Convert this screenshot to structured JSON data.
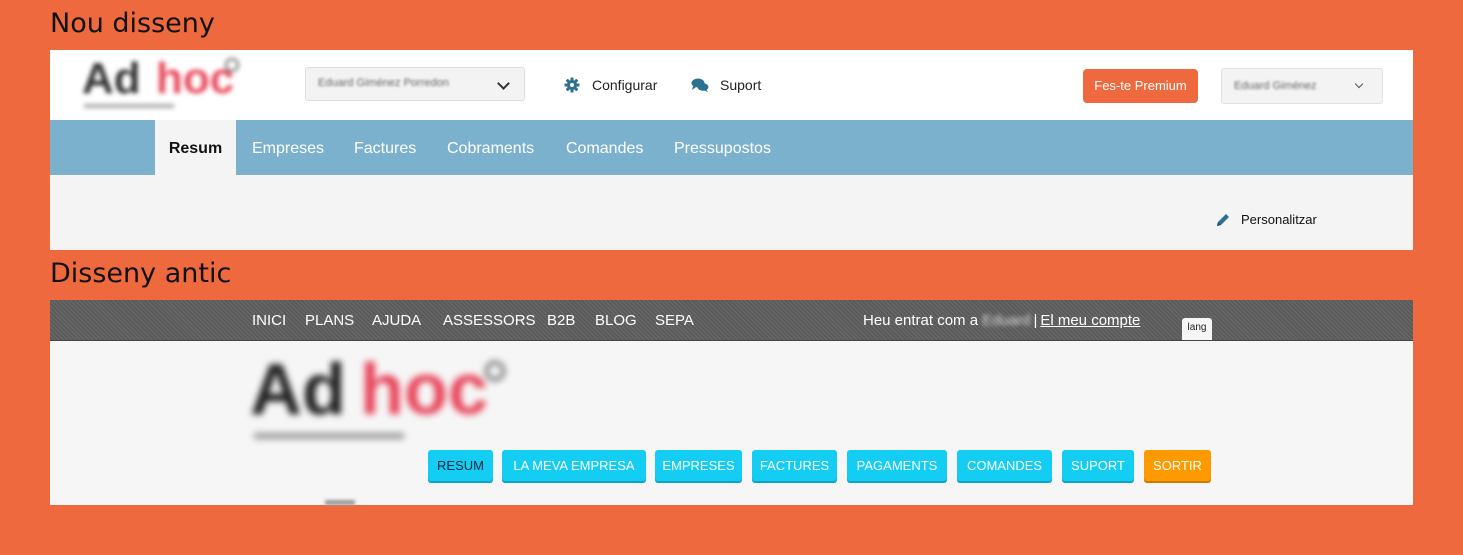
{
  "sections": {
    "new_title": "Nou disseny",
    "old_title": "Disseny antic"
  },
  "new_design": {
    "logo": {
      "text_left": "Ad",
      "text_right": "hoc",
      "brand_color": "#e84d5f"
    },
    "company_select": {
      "value": "Eduard Giménez Porredon"
    },
    "links": {
      "configurar": "Configurar",
      "suport": "Suport"
    },
    "premium_button": "Fes-te Premium",
    "user_select": {
      "value": "Eduard Giménez"
    },
    "nav": [
      "Resum",
      "Empreses",
      "Factures",
      "Cobraments",
      "Comandes",
      "Pressupostos"
    ],
    "active_nav": "Resum",
    "personalitzar": "Personalitzar",
    "colors": {
      "nav_bg": "#7bb1cd",
      "accent": "#ee6a3e"
    }
  },
  "old_design": {
    "top_links": [
      "INICI",
      "PLANS",
      "AJUDA",
      "ASSESSORS",
      "B2B",
      "BLOG",
      "SEPA"
    ],
    "account": {
      "prefix": "Heu entrat com a",
      "user": "Eduard",
      "separator": "|",
      "account_link": "El meu compte"
    },
    "lang": "lang",
    "logo": {
      "text_left": "Ad",
      "text_right": "hoc"
    },
    "buttons": [
      "RESUM",
      "LA MEVA EMPRESA",
      "EMPRESES",
      "FACTURES",
      "PAGAMENTS",
      "COMANDES",
      "SUPORT",
      "SORTIR"
    ],
    "colors": {
      "button_bg": "#13cdf2",
      "exit_bg": "#ff9900"
    }
  }
}
